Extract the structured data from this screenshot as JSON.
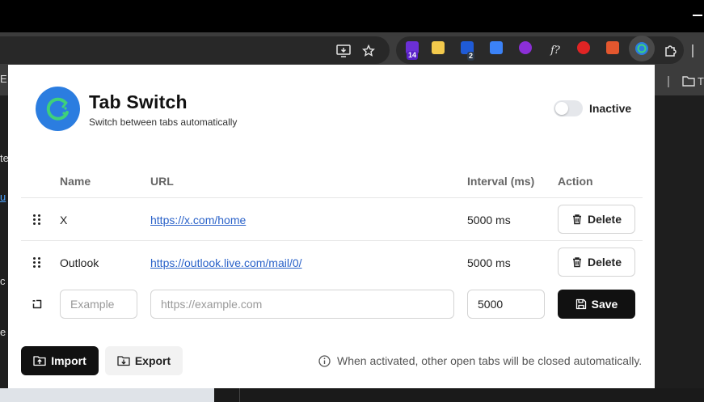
{
  "browser": {
    "extension_badges": [
      "14",
      "2"
    ],
    "bookmark_fragment": "T",
    "left_fragments": [
      "E",
      "te",
      "u",
      "c",
      "e"
    ]
  },
  "header": {
    "title": "Tab Switch",
    "subtitle": "Switch between tabs automatically",
    "toggle_state": "off",
    "status_label": "Inactive"
  },
  "table": {
    "columns": [
      "Name",
      "URL",
      "Interval (ms)",
      "Action"
    ],
    "rows": [
      {
        "name": "X",
        "url": "https://x.com/home",
        "interval": "5000 ms",
        "action": "Delete"
      },
      {
        "name": "Outlook",
        "url": "https://outlook.live.com/mail/0/",
        "interval": "5000 ms",
        "action": "Delete"
      }
    ],
    "new_row": {
      "name_placeholder": "Example",
      "url_placeholder": "https://example.com",
      "interval_value": "5000",
      "save_label": "Save"
    }
  },
  "footer": {
    "import_label": "Import",
    "export_label": "Export",
    "info_text": "When activated, other open tabs will be closed automatically."
  },
  "colors": {
    "accent": "#2b7de0",
    "logo_ring": "#3fd17a",
    "link": "#2a62c9",
    "dark_button": "#111111"
  }
}
